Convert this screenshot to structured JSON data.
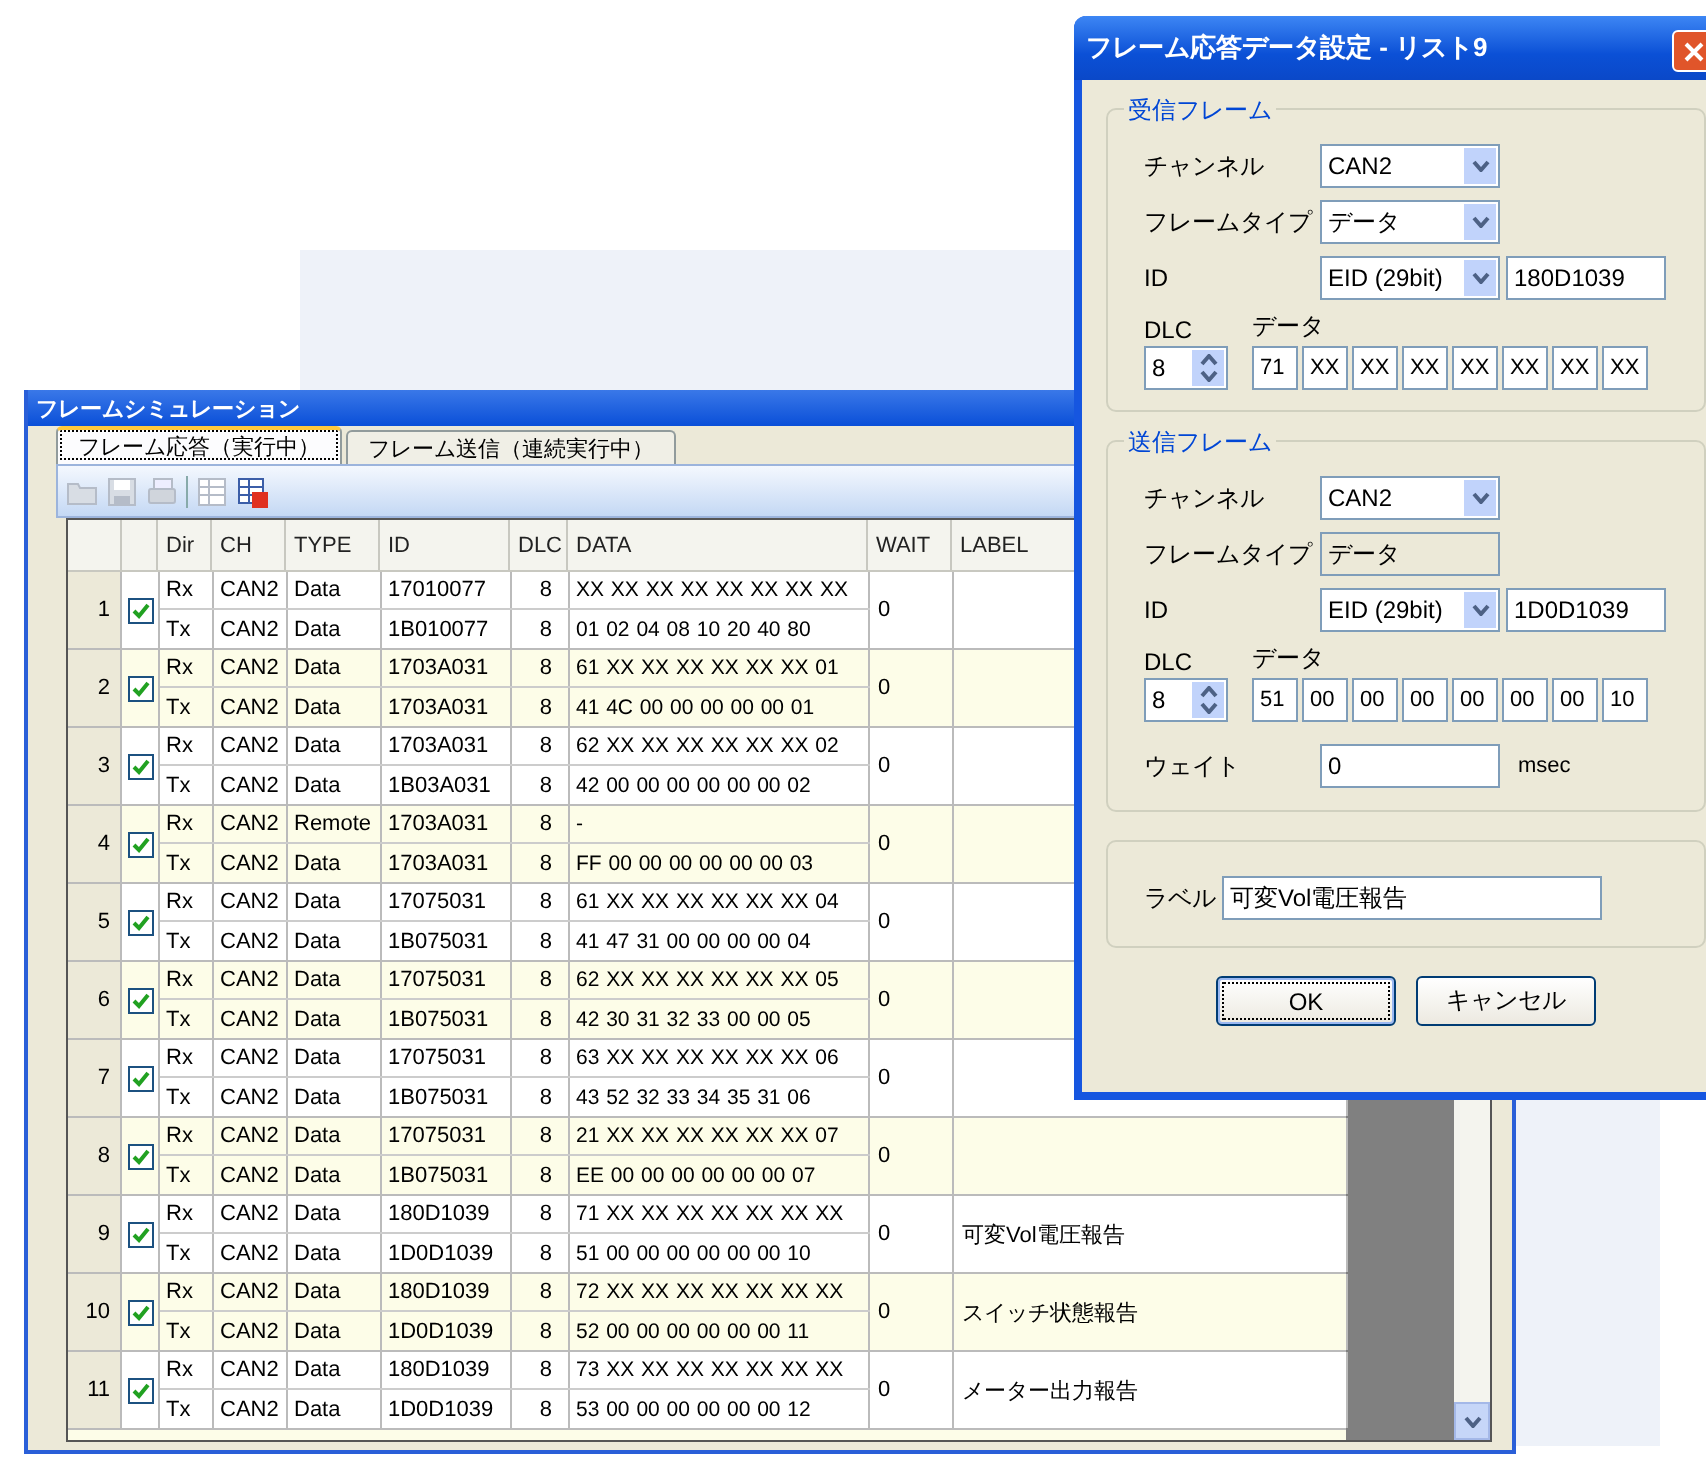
{
  "main_window": {
    "title": "フレームシミュレーション",
    "tabs": [
      {
        "label": "フレーム応答（実行中）",
        "selected": true
      },
      {
        "label": "フレーム送信（連続実行中）",
        "selected": false
      }
    ],
    "toolbar": [
      {
        "kind": "folder",
        "disabled": true
      },
      {
        "kind": "save",
        "disabled": true
      },
      {
        "kind": "document",
        "disabled": true
      },
      {
        "kind": "separator"
      },
      {
        "kind": "grid",
        "disabled": true
      },
      {
        "kind": "grid-badge",
        "disabled": false
      }
    ],
    "table": {
      "columns": [
        "Dir",
        "CH",
        "TYPE",
        "ID",
        "DLC",
        "DATA",
        "WAIT",
        "LABEL"
      ],
      "rows": [
        {
          "number": "1",
          "checked": true,
          "wait": "0",
          "frames": [
            {
              "dir": "Rx",
              "ch": "CAN2",
              "type": "Data",
              "id": "17010077",
              "dlc": "8",
              "data": "XX XX XX XX XX XX XX XX"
            },
            {
              "dir": "Tx",
              "ch": "CAN2",
              "type": "Data",
              "id": "1B010077",
              "dlc": "8",
              "data": "01 02 04 08 10 20 40 80"
            }
          ]
        },
        {
          "number": "2",
          "checked": true,
          "wait": "0",
          "frames": [
            {
              "dir": "Rx",
              "ch": "CAN2",
              "type": "Data",
              "id": "1703A031",
              "dlc": "8",
              "data": "61 XX XX XX XX XX XX 01"
            },
            {
              "dir": "Tx",
              "ch": "CAN2",
              "type": "Data",
              "id": "1703A031",
              "dlc": "8",
              "data": "41 4C 00 00 00 00 00 01"
            }
          ]
        },
        {
          "number": "3",
          "checked": true,
          "wait": "0",
          "frames": [
            {
              "dir": "Rx",
              "ch": "CAN2",
              "type": "Data",
              "id": "1703A031",
              "dlc": "8",
              "data": "62 XX XX XX XX XX XX 02"
            },
            {
              "dir": "Tx",
              "ch": "CAN2",
              "type": "Data",
              "id": "1B03A031",
              "dlc": "8",
              "data": "42 00 00 00 00 00 00 02"
            }
          ]
        },
        {
          "number": "4",
          "checked": true,
          "wait": "0",
          "frames": [
            {
              "dir": "Rx",
              "ch": "CAN2",
              "type": "Remote",
              "id": "1703A031",
              "dlc": "8",
              "data": "-"
            },
            {
              "dir": "Tx",
              "ch": "CAN2",
              "type": "Data",
              "id": "1703A031",
              "dlc": "8",
              "data": "FF 00 00 00 00 00 00 03"
            }
          ]
        },
        {
          "number": "5",
          "checked": true,
          "wait": "0",
          "frames": [
            {
              "dir": "Rx",
              "ch": "CAN2",
              "type": "Data",
              "id": "17075031",
              "dlc": "8",
              "data": "61 XX XX XX XX XX XX 04"
            },
            {
              "dir": "Tx",
              "ch": "CAN2",
              "type": "Data",
              "id": "1B075031",
              "dlc": "8",
              "data": "41 47 31 00 00 00 00 04"
            }
          ]
        },
        {
          "number": "6",
          "checked": true,
          "wait": "0",
          "frames": [
            {
              "dir": "Rx",
              "ch": "CAN2",
              "type": "Data",
              "id": "17075031",
              "dlc": "8",
              "data": "62 XX XX XX XX XX XX 05"
            },
            {
              "dir": "Tx",
              "ch": "CAN2",
              "type": "Data",
              "id": "1B075031",
              "dlc": "8",
              "data": "42 30 31 32 33 00 00 05"
            }
          ]
        },
        {
          "number": "7",
          "checked": true,
          "wait": "0",
          "frames": [
            {
              "dir": "Rx",
              "ch": "CAN2",
              "type": "Data",
              "id": "17075031",
              "dlc": "8",
              "data": "63 XX XX XX XX XX XX 06"
            },
            {
              "dir": "Tx",
              "ch": "CAN2",
              "type": "Data",
              "id": "1B075031",
              "dlc": "8",
              "data": "43 52 32 33 34 35 31 06"
            }
          ]
        },
        {
          "number": "8",
          "checked": true,
          "wait": "0",
          "frames": [
            {
              "dir": "Rx",
              "ch": "CAN2",
              "type": "Data",
              "id": "17075031",
              "dlc": "8",
              "data": "21 XX XX XX XX XX XX 07"
            },
            {
              "dir": "Tx",
              "ch": "CAN2",
              "type": "Data",
              "id": "1B075031",
              "dlc": "8",
              "data": "EE 00 00 00 00 00 00 07"
            }
          ]
        },
        {
          "number": "9",
          "checked": true,
          "wait": "0",
          "label": "可変Vol電圧報告",
          "frames": [
            {
              "dir": "Rx",
              "ch": "CAN2",
              "type": "Data",
              "id": "180D1039",
              "dlc": "8",
              "data": "71 XX XX XX XX XX XX XX"
            },
            {
              "dir": "Tx",
              "ch": "CAN2",
              "type": "Data",
              "id": "1D0D1039",
              "dlc": "8",
              "data": "51 00 00 00 00 00 00 10"
            }
          ]
        },
        {
          "number": "10",
          "checked": true,
          "wait": "0",
          "label": "スイッチ状態報告",
          "frames": [
            {
              "dir": "Rx",
              "ch": "CAN2",
              "type": "Data",
              "id": "180D1039",
              "dlc": "8",
              "data": "72 XX XX XX XX XX XX XX"
            },
            {
              "dir": "Tx",
              "ch": "CAN2",
              "type": "Data",
              "id": "1D0D1039",
              "dlc": "8",
              "data": "52 00 00 00 00 00 00 11"
            }
          ]
        },
        {
          "number": "11",
          "checked": true,
          "wait": "0",
          "label": "メーター出力報告",
          "frames": [
            {
              "dir": "Rx",
              "ch": "CAN2",
              "type": "Data",
              "id": "180D1039",
              "dlc": "8",
              "data": "73 XX XX XX XX XX XX XX"
            },
            {
              "dir": "Tx",
              "ch": "CAN2",
              "type": "Data",
              "id": "1D0D1039",
              "dlc": "8",
              "data": "53 00 00 00 00 00 00 12"
            }
          ]
        }
      ]
    }
  },
  "dialog": {
    "title": "フレーム応答データ設定 - リスト9",
    "groups": [
      {
        "title": "受信フレーム",
        "channel_label": "チャンネル",
        "channel": "CAN2",
        "frame_type_label": "フレームタイプ",
        "frame_type": "データ",
        "frame_type_disabled": false,
        "id_label": "ID",
        "id_format": "EID (29bit)",
        "id": "180D1039",
        "dlc_label": "DLC",
        "dlc": "8",
        "data_label": "データ",
        "data": [
          "71",
          "XX",
          "XX",
          "XX",
          "XX",
          "XX",
          "XX",
          "XX"
        ]
      },
      {
        "title": "送信フレーム",
        "channel_label": "チャンネル",
        "channel": "CAN2",
        "frame_type_label": "フレームタイプ",
        "frame_type": "データ",
        "frame_type_disabled": true,
        "id_label": "ID",
        "id_format": "EID (29bit)",
        "id": "1D0D1039",
        "dlc_label": "DLC",
        "dlc": "8",
        "data_label": "データ",
        "data": [
          "51",
          "00",
          "00",
          "00",
          "00",
          "00",
          "00",
          "10"
        ],
        "wait_label": "ウェイト",
        "wait": "0",
        "wait_unit": "msec"
      }
    ],
    "label_label": "ラベル",
    "label": "可変Vol電圧報告",
    "buttons": [
      {
        "label": "OK",
        "focused": true
      },
      {
        "label": "キャンセル",
        "focused": false
      }
    ]
  }
}
